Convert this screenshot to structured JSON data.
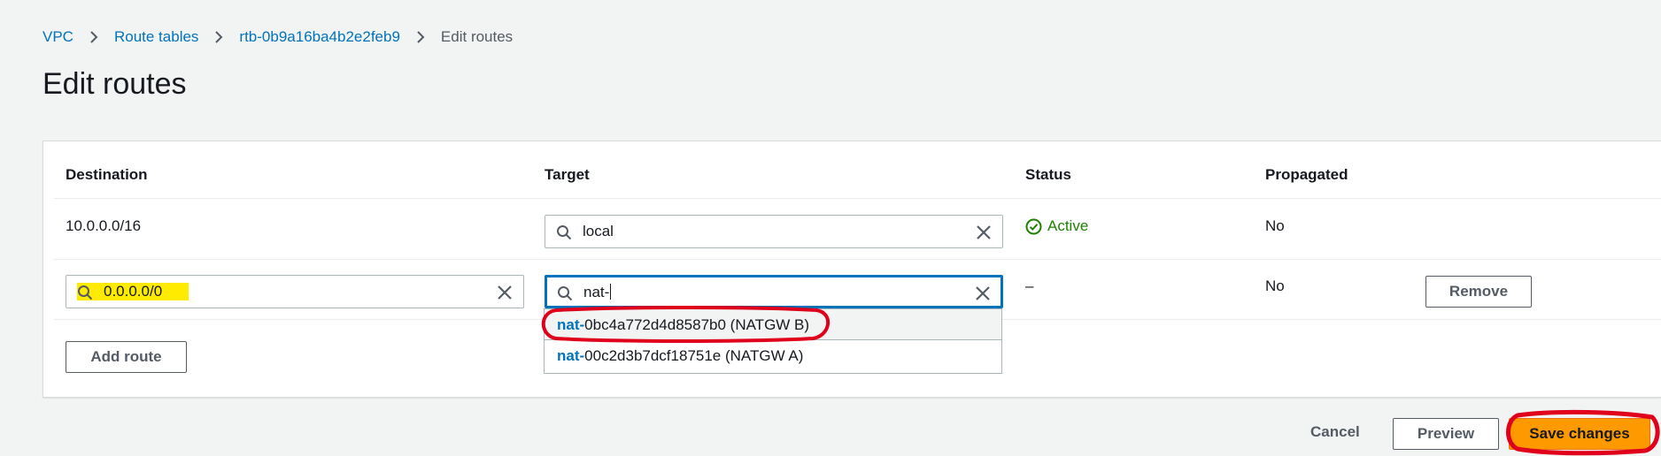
{
  "breadcrumb": [
    {
      "label": "VPC"
    },
    {
      "label": "Route tables"
    },
    {
      "label": "rtb-0b9a16ba4b2e2feb9"
    },
    {
      "label": "Edit routes"
    }
  ],
  "page_title": "Edit routes",
  "table": {
    "headers": {
      "destination": "Destination",
      "target": "Target",
      "status": "Status",
      "propagated": "Propagated"
    },
    "rows": [
      {
        "destination": "10.0.0.0/16",
        "target": "local",
        "status": "Active",
        "propagated": "No"
      },
      {
        "destination": "0.0.0.0/0",
        "target": "nat-",
        "status": "–",
        "propagated": "No",
        "remove_label": "Remove"
      }
    ]
  },
  "dropdown": {
    "match_text": "nat-",
    "options": [
      {
        "rest": "0bc4a772d4d8587b0 (NATGW B)"
      },
      {
        "rest": "00c2d3b7dcf18751e (NATGW A)"
      }
    ]
  },
  "buttons": {
    "add_route": "Add route",
    "cancel": "Cancel",
    "preview": "Preview",
    "save": "Save changes"
  },
  "colors": {
    "link": "#0073bb",
    "primary": "#ff9900",
    "success": "#1d8102",
    "annotation": "#e0001b",
    "highlight": "#ffeb00"
  },
  "icons": [
    "chevron-right-icon",
    "search-icon",
    "clear-icon",
    "status-success-icon"
  ]
}
